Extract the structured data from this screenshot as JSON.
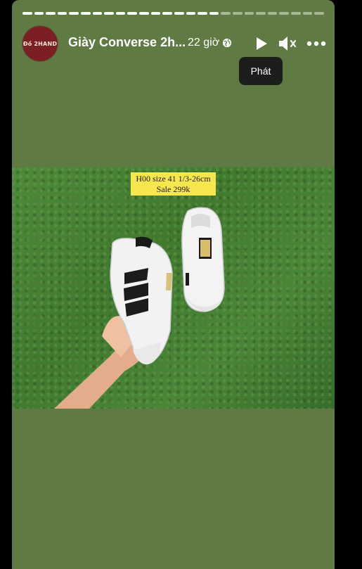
{
  "story": {
    "author_avatar_text": "Đồ 2HAND",
    "title": "Giày Converse 2h...",
    "time": "22 giờ",
    "tooltip": "Phát",
    "progress_segments_total": 26,
    "progress_segments_viewed": 17
  },
  "photo": {
    "price_tag_line1": "H00 size 41 1/3-26cm",
    "price_tag_line2": "Sale 299k"
  },
  "colors": {
    "background": "#5f7a43",
    "avatar": "#7b1f24",
    "tooltip": "#1c1e1c",
    "price_tag": "#f7e64d"
  },
  "icons": [
    "globe-icon",
    "play-icon",
    "speaker-muted-icon",
    "more-icon"
  ]
}
